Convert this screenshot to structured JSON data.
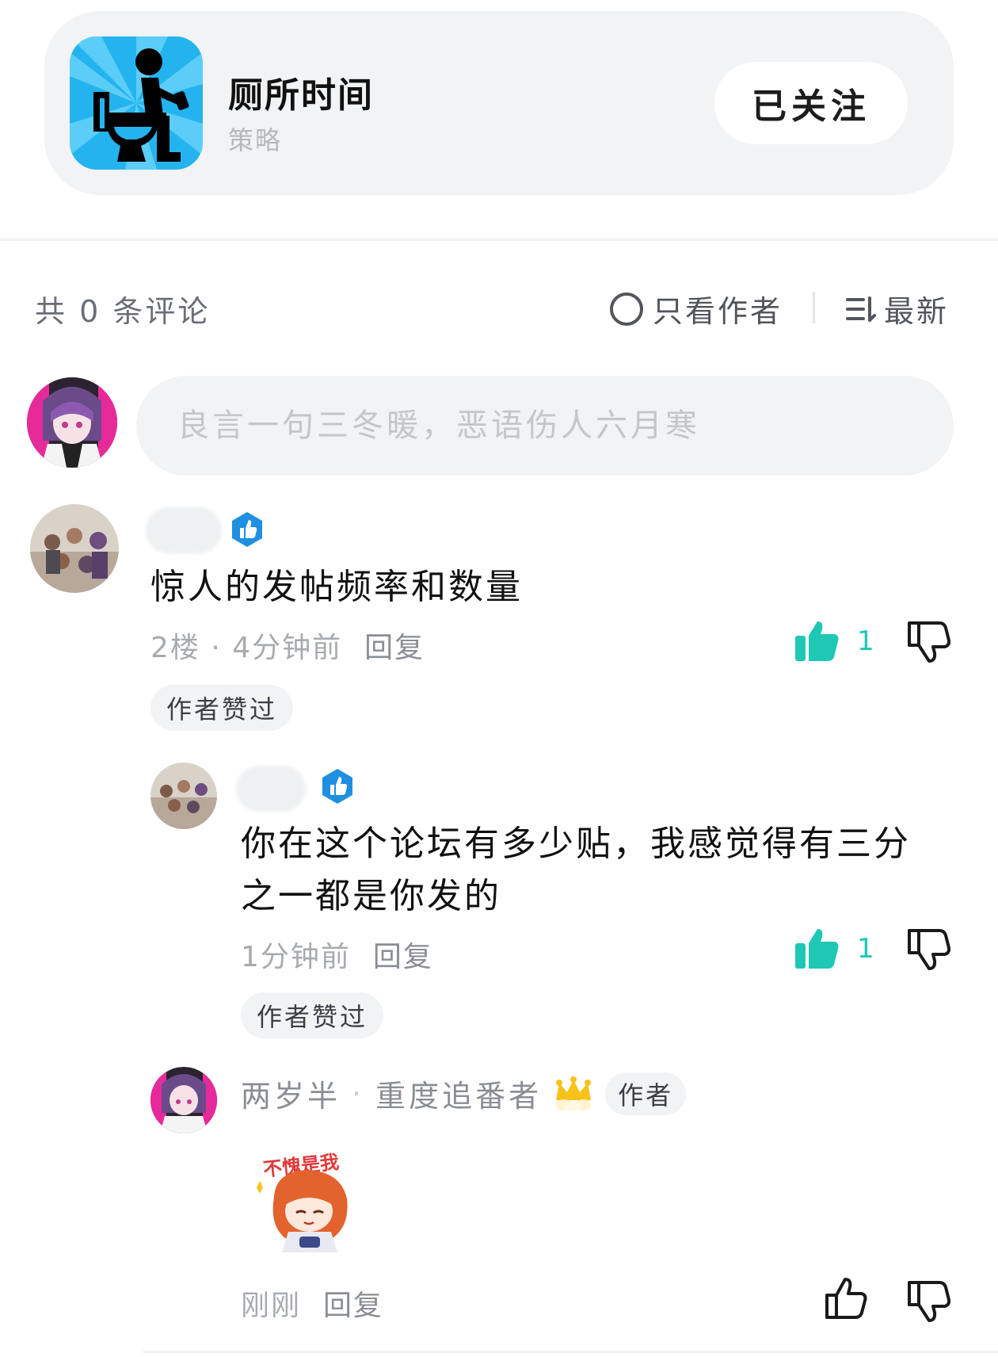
{
  "game": {
    "title": "厕所时间",
    "tag": "策略",
    "follow_label": "已关注",
    "icon": "toilet-person-icon"
  },
  "filter": {
    "count_text": "共 0 条评论",
    "only_author_label": "只看作者",
    "sort_label": "最新"
  },
  "composer": {
    "placeholder": "良言一句三冬暖，恶语伤人六月寒"
  },
  "comments": [
    {
      "text": "惊人的发帖频率和数量",
      "floor": "2楼",
      "time": "4分钟前",
      "reply_label": "回复",
      "likes": "1",
      "author_liked": "作者赞过"
    }
  ],
  "replies": [
    {
      "text_line1": "你在这个论坛有多少贴，我感觉得有三分",
      "text_line2": "之一都是你发的",
      "time": "1分钟前",
      "reply_label": "回复",
      "likes": "1",
      "author_liked": "作者赞过"
    },
    {
      "name": "两岁半",
      "title": "重度追番者",
      "author_chip": "作者",
      "sticker_text": "不愧是我",
      "time": "刚刚",
      "reply_label": "回复"
    }
  ],
  "colors": {
    "accent_teal": "#1fc8b4",
    "badge_blue": "#1e8fe1",
    "card_bg": "#f1f3f5"
  }
}
